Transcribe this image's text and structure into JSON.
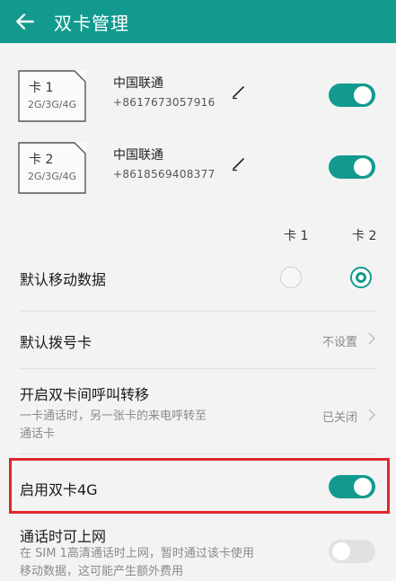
{
  "header": {
    "title": "双卡管理"
  },
  "sims": [
    {
      "card_label": "卡 1",
      "network": "2G/3G/4G",
      "carrier": "中国联通",
      "number": "+8617673057916",
      "enabled": true
    },
    {
      "card_label": "卡 2",
      "network": "2G/3G/4G",
      "carrier": "中国联通",
      "number": "+8618569408377",
      "enabled": true
    }
  ],
  "columns": {
    "card1": "卡 1",
    "card2": "卡 2"
  },
  "settings": {
    "default_data": {
      "title": "默认移动数据",
      "selected": "卡 2"
    },
    "default_dial": {
      "title": "默认拨号卡",
      "value": "不设置"
    },
    "call_forward": {
      "title": "开启双卡间呼叫转移",
      "desc_line1": "一卡通话时，另一张卡的来电呼转至",
      "desc_line2": "通话卡",
      "value": "已关闭"
    },
    "dual_4g": {
      "title": "启用双卡4G",
      "enabled": true
    },
    "data_during_call": {
      "title": "通话时可上网",
      "desc_line1": "在 SIM 1高清通话时上网，暂时通过该卡使用",
      "desc_line2": "移动数据，这可能产生额外费用",
      "enabled": false
    }
  },
  "colors": {
    "accent": "#129a8f",
    "highlight": "#e0262b"
  }
}
